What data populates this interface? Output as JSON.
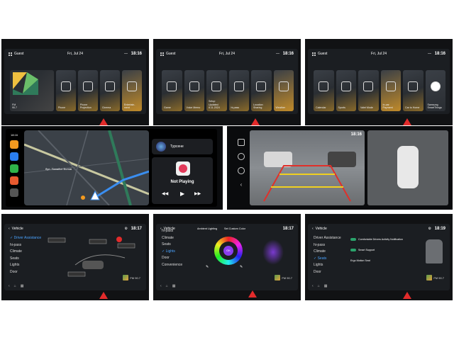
{
  "status": {
    "user": "Guest",
    "date": "Fri, Jul 24",
    "time_1": "18:16",
    "time_2": "18:17",
    "time_3": "18:19",
    "vehicle": "Vehicle"
  },
  "home1": {
    "tiles": [
      {
        "label": "FM\n90.7",
        "icon": "radio-icon"
      },
      {
        "label": "Phone",
        "icon": "phone-icon"
      },
      {
        "label": "Phone\nProjection",
        "icon": "phone-projection-icon"
      },
      {
        "label": "Cinema",
        "icon": "cinema-icon"
      },
      {
        "label": "Entertain-\nment",
        "icon": "entertainment-icon"
      }
    ]
  },
  "home2": {
    "tiles": [
      {
        "label": "Game",
        "icon": "game-icon"
      },
      {
        "label": "Voice Memo",
        "icon": "voice-memo-icon"
      },
      {
        "label": "Setup\nUpdated\n8.11.2024",
        "icon": "setup-icon"
      },
      {
        "label": "hi-pass",
        "icon": "hipass-icon"
      },
      {
        "label": "Location\nSharing",
        "icon": "location-icon"
      },
      {
        "label": "Weather",
        "icon": "weather-icon"
      }
    ]
  },
  "home3": {
    "tiles": [
      {
        "label": "Calendar",
        "icon": "calendar-icon"
      },
      {
        "label": "Sports",
        "icon": "sports-icon"
      },
      {
        "label": "Valet Mode",
        "icon": "valet-icon"
      },
      {
        "label": "In-car\nPayment",
        "icon": "payment-icon"
      },
      {
        "label": "Car to Home",
        "icon": "car-home-icon"
      },
      {
        "label": "Samsung\nSmartThings",
        "icon": "smartthings-icon"
      }
    ]
  },
  "carplay": {
    "street": "бул. Панайот Волов",
    "app": "Турсене",
    "player": "Not Playing"
  },
  "vehicle1": {
    "menu": [
      "Driver Assistance",
      "hi-pass",
      "Climate",
      "Seats",
      "Lights",
      "Door"
    ],
    "active": "Driver Assistance",
    "radio": "FM 90.7"
  },
  "vehicle2": {
    "menu": [
      "hi-pass",
      "Climate",
      "Seats",
      "Lights",
      "Door",
      "Convenience"
    ],
    "active": "Lights",
    "tabs": [
      "Ambient Lighting",
      "Set Custom Color"
    ],
    "ok": "OK",
    "radio": "FM 90.7"
  },
  "vehicle3": {
    "menu": [
      "Driver Assistance",
      "hi-pass",
      "Climate",
      "Seats",
      "Lights",
      "Door"
    ],
    "active": "Seats",
    "options": [
      "Comfortable Drivers Activity Notification",
      "Smart Support",
      "Ergo Motion Seat"
    ],
    "radio": "FM 90.7"
  }
}
